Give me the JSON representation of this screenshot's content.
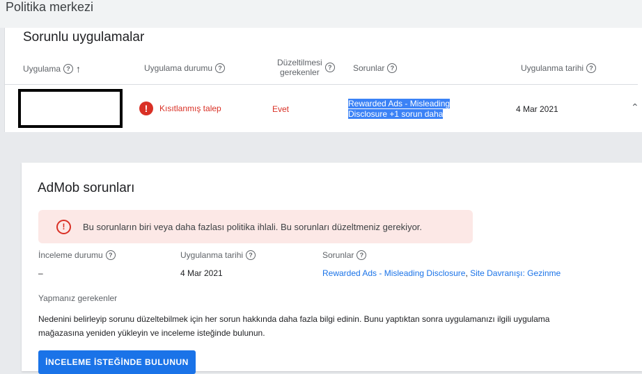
{
  "page_title": "Politika merkezi",
  "problem_apps": {
    "title": "Sorunlu uygulamalar",
    "columns": {
      "app": "Uygulama",
      "status": "Uygulama durumu",
      "fix_needed_line1": "Düzeltilmesi",
      "fix_needed_line2": "gerekenler",
      "issues": "Sorunlar",
      "enforcement_date": "Uygulanma tarihi"
    },
    "row": {
      "status": "Kısıtlanmış talep",
      "fix_needed": "Evet",
      "issues_line1": "Rewarded Ads - Misleading",
      "issues_line2": "Disclosure +1 sorun daha",
      "date": "4 Mar 2021"
    }
  },
  "admob": {
    "title": "AdMob sorunları",
    "alert": "Bu sorunların biri veya daha fazlası politika ihlali. Bu sorunları düzeltmeniz gerekiyor.",
    "review_status_label": "İnceleme durumu",
    "review_status_value": "–",
    "enforcement_date_label": "Uygulanma tarihi",
    "enforcement_date_value": "4 Mar 2021",
    "issues_label": "Sorunlar",
    "issue_link1": "Rewarded Ads - Misleading Disclosure",
    "issue_sep": ",",
    "issue_link2": "Site Davranışı: Gezinme",
    "todo_label": "Yapmanız gerekenler",
    "description": "Nedenini belirleyip sorunu düzeltebilmek için her sorun hakkında daha fazla bilgi edinin. Bunu yaptıktan sonra uygulamanızı ilgili uygulama mağazasına yeniden yükleyin ve inceleme isteğinde bulunun.",
    "cta": "İNCELEME İSTEĞİNDE BULUNUN"
  },
  "colors": {
    "error": "#d93025",
    "link": "#1a73e8",
    "alert_bg": "#fce8e6",
    "selection": "#3b82f6"
  }
}
